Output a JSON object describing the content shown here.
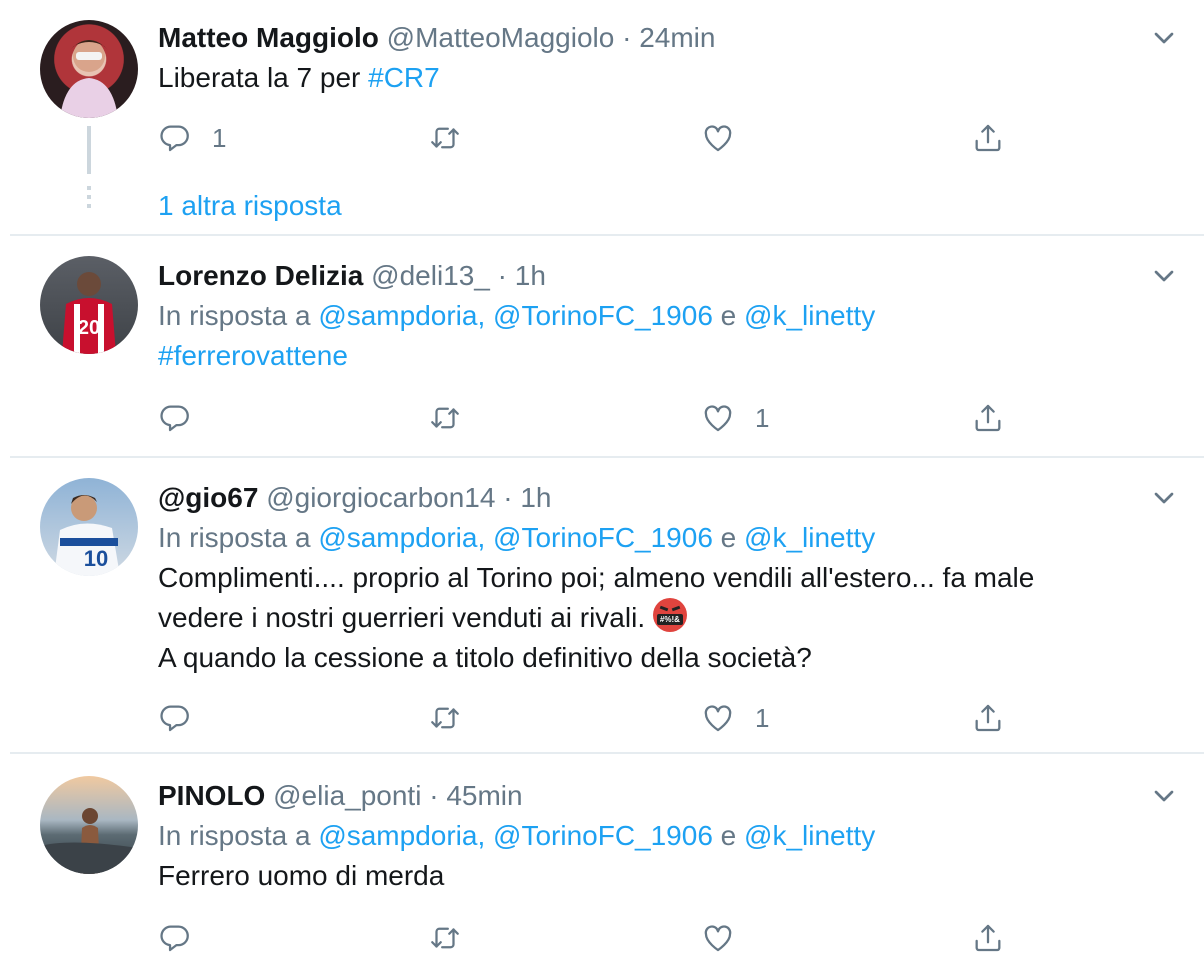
{
  "tweets": [
    {
      "name": "Matteo Maggiolo",
      "handle": "@MatteoMaggiolo",
      "sep": "·",
      "time": "24min",
      "text_prefix": "Liberata la 7 per ",
      "hashtag": "#CR7",
      "reply_count": "1",
      "like_count": "",
      "more_replies": "1 altra risposta"
    },
    {
      "name": "Lorenzo Delizia",
      "handle": "@deli13_",
      "sep": "·",
      "time": "1h",
      "reply_prefix": "In risposta a ",
      "mention1": "@sampdoria",
      "comma": ",",
      "mention2": "@TorinoFC_1906",
      "and": " e ",
      "mention3": "@k_linetty",
      "hashtag": "#ferrerovattene",
      "reply_count": "",
      "like_count": "1"
    },
    {
      "name": "@gio67",
      "handle": "@giorgiocarbon14",
      "sep": "·",
      "time": "1h",
      "reply_prefix": "In risposta a ",
      "mention1": "@sampdoria",
      "comma": ",",
      "mention2": "@TorinoFC_1906",
      "and": " e ",
      "mention3": "@k_linetty",
      "line1": "Complimenti.... proprio al Torino poi; almeno vendili all'estero... fa male",
      "line2": "vedere i nostri guerrieri venduti ai rivali.",
      "emoji_text": "#%!&",
      "line3": "A quando la cessione a titolo definitivo della società?",
      "reply_count": "",
      "like_count": "1"
    },
    {
      "name": "PINOLO",
      "handle": "@elia_ponti",
      "sep": "·",
      "time": "45min",
      "reply_prefix": "In risposta a ",
      "mention1": "@sampdoria",
      "comma": ",",
      "mention2": "@TorinoFC_1906",
      "and": " e ",
      "mention3": "@k_linetty",
      "text": "Ferrero uomo di merda",
      "reply_count": "",
      "like_count": ""
    }
  ],
  "icons": [
    "reply-icon",
    "retweet-icon",
    "like-icon",
    "share-icon",
    "chevron-down-icon"
  ],
  "colors": {
    "link": "#1da1f2",
    "secondary": "#657786",
    "divider": "#e6ecf0",
    "text": "#14171a"
  }
}
